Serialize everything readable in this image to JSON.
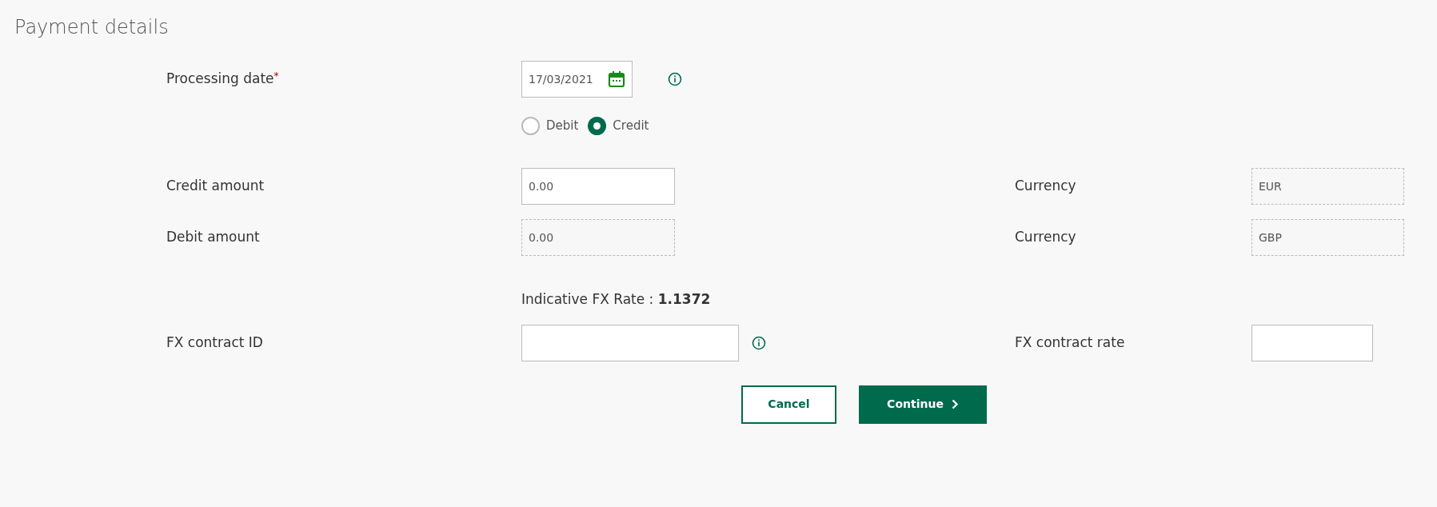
{
  "title": "Payment details",
  "processing_date": {
    "label": "Processing date",
    "required_mark": "*",
    "value": "17/03/2021"
  },
  "direction": [
    {
      "label": "Debit",
      "selected": false
    },
    {
      "label": "Credit",
      "selected": true
    }
  ],
  "amount_rows": [
    {
      "label": "Credit amount",
      "value": "0.00",
      "disabled": false,
      "currency_label": "Currency",
      "currency": "EUR"
    },
    {
      "label": "Debit amount",
      "value": "0.00",
      "disabled": true,
      "currency_label": "Currency",
      "currency": "GBP"
    }
  ],
  "indicative_rate": "Indicative FX Rate : **1.1372**",
  "fx_contract": {
    "id_label": "FX contract ID",
    "rate_label": "FX contract rate"
  },
  "buttons": [
    {
      "label": "Cancel",
      "kind": "secondary"
    },
    {
      "label": "Continue",
      "kind": "primary"
    }
  ]
}
